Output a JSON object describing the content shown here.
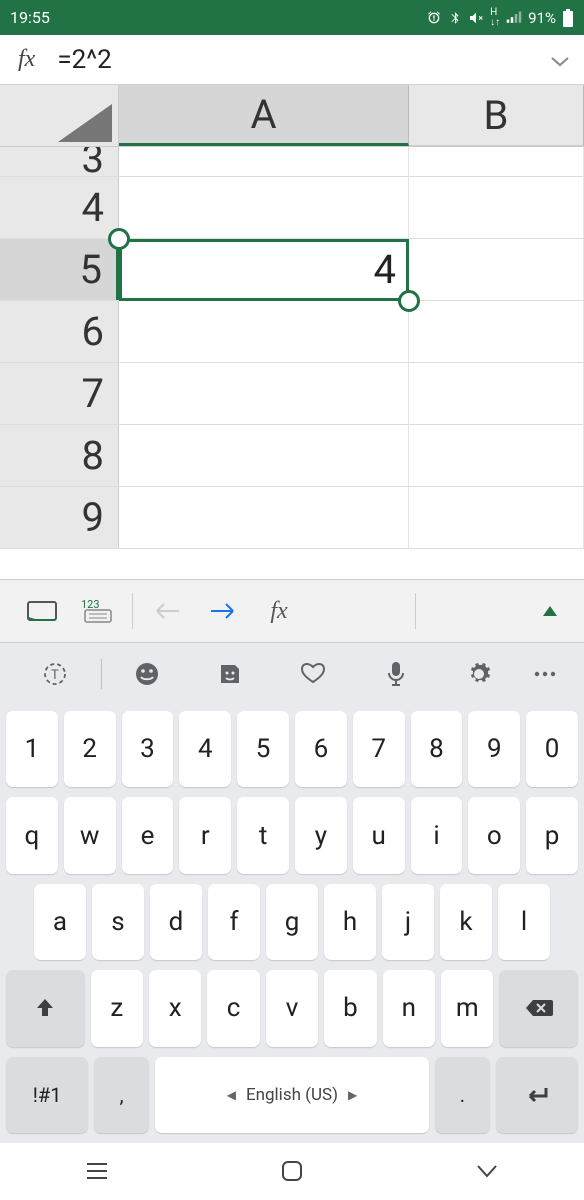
{
  "status": {
    "time": "19:55",
    "battery": "91%"
  },
  "formula": {
    "fx": "fx",
    "text": "=2^2"
  },
  "sheet": {
    "cols": [
      "A",
      "B"
    ],
    "rows": [
      "3",
      "4",
      "5",
      "6",
      "7",
      "8",
      "9"
    ],
    "selected_cell_value": "4",
    "selected_row": "5",
    "selected_col": "A"
  },
  "toolbar": {
    "fx": "fx"
  },
  "keyboard": {
    "num_row": [
      "1",
      "2",
      "3",
      "4",
      "5",
      "6",
      "7",
      "8",
      "9",
      "0"
    ],
    "row1": [
      "q",
      "w",
      "e",
      "r",
      "t",
      "y",
      "u",
      "i",
      "o",
      "p"
    ],
    "row2": [
      "a",
      "s",
      "d",
      "f",
      "g",
      "h",
      "j",
      "k",
      "l"
    ],
    "row3": [
      "z",
      "x",
      "c",
      "v",
      "b",
      "n",
      "m"
    ],
    "sym": "!#1",
    "comma": ",",
    "space": "English (US)",
    "period": "."
  }
}
